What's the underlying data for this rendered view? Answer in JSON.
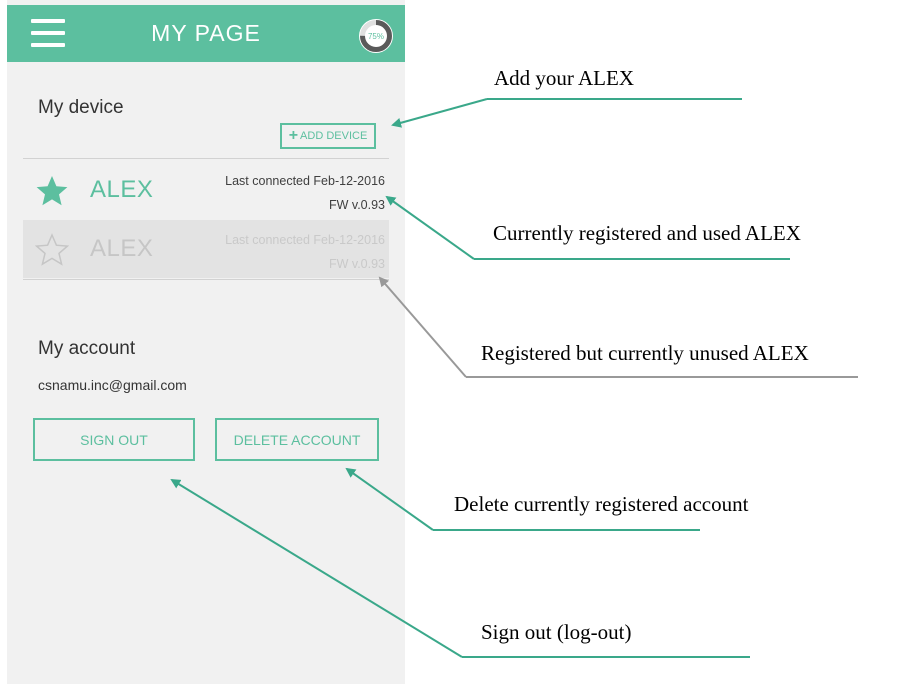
{
  "header": {
    "title": "MY PAGE",
    "progress_label": "75%",
    "progress_fraction": 0.75
  },
  "my_device": {
    "title": "My device",
    "add_button_label": "ADD DEVICE",
    "devices": [
      {
        "name": "ALEX",
        "last_connected": "Last  connected Feb-12-2016",
        "fw": "FW v.0.93",
        "state": "active"
      },
      {
        "name": "ALEX",
        "last_connected": "Last  connected Feb-12-2016",
        "fw": "FW v.0.93",
        "state": "inactive"
      }
    ]
  },
  "my_account": {
    "title": "My account",
    "email": "csnamu.inc@gmail.com",
    "sign_out_label": "SIGN OUT",
    "delete_account_label": "DELETE ACCOUNT"
  },
  "annotations": {
    "add_alex": "Add your ALEX",
    "current_alex": "Currently registered and used ALEX",
    "unused_alex": "Registered but currently unused ALEX",
    "delete_account": "Delete currently registered account",
    "sign_out": "Sign out (log-out)"
  },
  "colors": {
    "accent": "#5cbf9f",
    "screen_bg": "#f1f1f1",
    "inactive_row": "#e3e3e3",
    "annotation_line_gray": "#999999"
  },
  "icons": {
    "menu": "hamburger-icon",
    "progress": "progress-ring-icon",
    "add": "plus-icon",
    "active_device": "star-filled-icon",
    "inactive_device": "star-outline-icon"
  }
}
